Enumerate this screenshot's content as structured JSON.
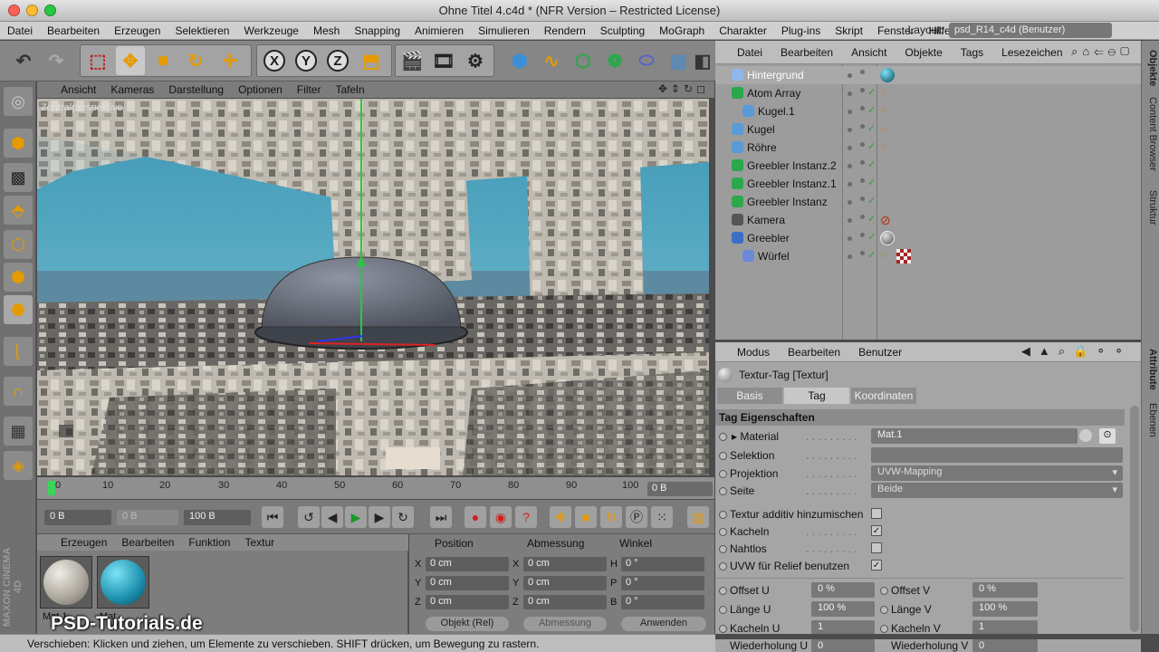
{
  "window": {
    "title": "Ohne Titel 4.c4d * (NFR Version – Restricted License)"
  },
  "menubar": {
    "items": [
      "Datei",
      "Bearbeiten",
      "Erzeugen",
      "Selektieren",
      "Werkzeuge",
      "Mesh",
      "Snapping",
      "Animieren",
      "Simulieren",
      "Rendern",
      "Sculpting",
      "MoGraph",
      "Charakter",
      "Plug-ins",
      "Skript",
      "Fenster",
      "Hilfe"
    ],
    "layout_label": "Layout:",
    "layout_value": "psd_R14_c4d (Benutzer)"
  },
  "toolbar": {
    "axis_x": "X",
    "axis_y": "Y",
    "axis_z": "Z"
  },
  "viewport": {
    "menu": [
      "Ansicht",
      "Kameras",
      "Darstellung",
      "Optionen",
      "Filter",
      "Tafeln"
    ],
    "label": "Zentralperspektive"
  },
  "timeline": {
    "ticks": [
      "0",
      "10",
      "20",
      "30",
      "40",
      "50",
      "60",
      "70",
      "80",
      "90",
      "100"
    ],
    "current_frame": "0 B"
  },
  "transport": {
    "start": "0 B",
    "preview_start": "0 B",
    "end": "100 B"
  },
  "material_manager": {
    "menu": [
      "Erzeugen",
      "Bearbeiten",
      "Funktion",
      "Textur"
    ],
    "materials": [
      {
        "name": "Mat.1"
      },
      {
        "name": "Mat"
      }
    ]
  },
  "coordinates": {
    "headers": [
      "Position",
      "Abmessung",
      "Winkel"
    ],
    "rows": [
      {
        "axis": "X",
        "pos": "0 cm",
        "size_axis": "X",
        "size": "0 cm",
        "rot_axis": "H",
        "rot": "0 °"
      },
      {
        "axis": "Y",
        "pos": "0 cm",
        "size_axis": "Y",
        "size": "0 cm",
        "rot_axis": "P",
        "rot": "0 °"
      },
      {
        "axis": "Z",
        "pos": "0 cm",
        "size_axis": "Z",
        "size": "0 cm",
        "rot_axis": "B",
        "rot": "0 °"
      }
    ],
    "mode": "Objekt (Rel)",
    "size_mode": "Abmessung",
    "apply": "Anwenden"
  },
  "object_manager": {
    "menu": [
      "Datei",
      "Bearbeiten",
      "Ansicht",
      "Objekte",
      "Tags",
      "Lesezeichen"
    ],
    "objects": [
      {
        "name": "Hintergrund",
        "indent": 0,
        "color": "#ffffff"
      },
      {
        "name": "Atom Array",
        "indent": 0,
        "color": "#111111"
      },
      {
        "name": "Kugel.1",
        "indent": 1,
        "color": "#111111"
      },
      {
        "name": "Kugel",
        "indent": 0,
        "color": "#111111"
      },
      {
        "name": "Röhre",
        "indent": 0,
        "color": "#111111"
      },
      {
        "name": "Greebler Instanz.2",
        "indent": 0,
        "color": "#111111"
      },
      {
        "name": "Greebler Instanz.1",
        "indent": 0,
        "color": "#111111"
      },
      {
        "name": "Greebler Instanz",
        "indent": 0,
        "color": "#111111"
      },
      {
        "name": "Kamera",
        "indent": 0,
        "color": "#111111"
      },
      {
        "name": "Greebler",
        "indent": 0,
        "color": "#111111"
      },
      {
        "name": "Würfel",
        "indent": 1,
        "color": "#111111"
      }
    ]
  },
  "side_tabs": [
    "Objekte",
    "Content Browser",
    "Struktur",
    "Attribute",
    "Ebenen"
  ],
  "attribute_manager": {
    "menu": [
      "Modus",
      "Bearbeiten",
      "Benutzer"
    ],
    "title": "Textur-Tag [Textur]",
    "tabs": [
      "Basis",
      "Tag",
      "Koordinaten"
    ],
    "active_tab": "Tag",
    "section": "Tag Eigenschaften",
    "fields": {
      "material_label": "Material",
      "material_value": "Mat.1",
      "selektion_label": "Selektion",
      "projektion_label": "Projektion",
      "projektion_value": "UVW-Mapping",
      "seite_label": "Seite",
      "seite_value": "Beide",
      "additiv_label": "Textur additiv hinzumischen",
      "kacheln_label": "Kacheln",
      "nahtlos_label": "Nahtlos",
      "uvw_label": "UVW für Relief benutzen",
      "offset_u_label": "Offset U",
      "offset_u_value": "0 %",
      "offset_v_label": "Offset V",
      "offset_v_value": "0 %",
      "laenge_u_label": "Länge U",
      "laenge_u_value": "100 %",
      "laenge_v_label": "Länge V",
      "laenge_v_value": "100 %",
      "kacheln_u_label": "Kacheln U",
      "kacheln_u_value": "1",
      "kacheln_v_label": "Kacheln V",
      "kacheln_v_value": "1",
      "wdh_u_label": "Wiederholung U",
      "wdh_u_value": "0",
      "wdh_v_label": "Wiederholung V",
      "wdh_v_value": "0"
    },
    "checks": {
      "additiv": false,
      "kacheln": true,
      "nahtlos": false,
      "uvw": true
    }
  },
  "status": "Verschieben: Klicken und ziehen, um Elemente zu verschieben. SHIFT drücken, um Bewegung zu rastern.",
  "branding": {
    "watermark": "PSD-Tutorials.de",
    "maxon": "MAXON CINEMA 4D"
  }
}
